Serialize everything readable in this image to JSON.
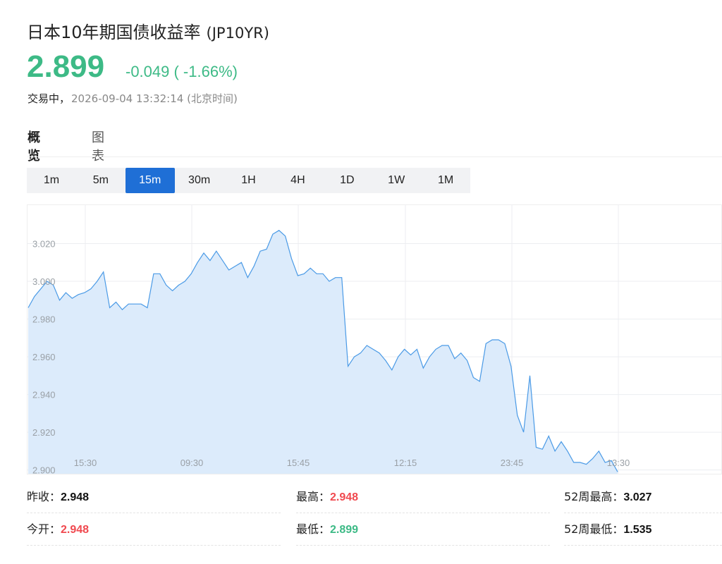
{
  "header": {
    "title": "日本10年期国债收益率",
    "code": "(JP10YR)",
    "price": "2.899",
    "change": "-0.049 ( -1.66%)",
    "status": "交易中，",
    "timestamp": "2026-09-04 13:32:14 (北京时间)"
  },
  "tabs": [
    {
      "label": "概览",
      "active": true
    },
    {
      "label": "图表",
      "active": false
    }
  ],
  "periods": [
    "1m",
    "5m",
    "15m",
    "30m",
    "1H",
    "4H",
    "1D",
    "1W",
    "1M"
  ],
  "selected_period": "15m",
  "colors": {
    "up": "#f0494f",
    "down": "#3dba86",
    "accent": "#1f6fd6",
    "line": "#4a9ae6",
    "fill": "#dcebfb"
  },
  "chart_data": {
    "type": "area",
    "y_ticks": [
      "3.020",
      "3.000",
      "2.980",
      "2.960",
      "2.940",
      "2.920",
      "2.900"
    ],
    "x_ticks": [
      "15:30",
      "09:30",
      "15:45",
      "12:15",
      "23:45",
      "13:30"
    ],
    "ylim": [
      2.9,
      3.03
    ],
    "grid": true,
    "values": [
      2.986,
      2.992,
      2.996,
      3.0,
      2.998,
      2.99,
      2.994,
      2.991,
      2.993,
      2.994,
      2.996,
      3.0,
      3.005,
      2.986,
      2.989,
      2.985,
      2.988,
      2.988,
      2.988,
      2.986,
      3.004,
      3.004,
      2.998,
      2.995,
      2.998,
      3.0,
      3.004,
      3.01,
      3.015,
      3.011,
      3.016,
      3.011,
      3.006,
      3.008,
      3.01,
      3.002,
      3.008,
      3.016,
      3.017,
      3.025,
      3.027,
      3.024,
      3.012,
      3.003,
      3.004,
      3.007,
      3.004,
      3.004,
      3.0,
      3.002,
      3.002,
      2.955,
      2.96,
      2.962,
      2.966,
      2.964,
      2.962,
      2.958,
      2.953,
      2.96,
      2.964,
      2.961,
      2.964,
      2.954,
      2.96,
      2.964,
      2.966,
      2.966,
      2.959,
      2.962,
      2.958,
      2.949,
      2.947,
      2.967,
      2.969,
      2.969,
      2.967,
      2.955,
      2.929,
      2.92,
      2.95,
      2.912,
      2.911,
      2.918,
      2.91,
      2.915,
      2.91,
      2.904,
      2.904,
      2.903,
      2.906,
      2.91,
      2.904,
      2.905,
      2.899
    ]
  },
  "stats": [
    [
      {
        "label": "昨收：",
        "value": "2.948",
        "color": "black"
      },
      {
        "label": "最高：",
        "value": "2.948",
        "color": "red"
      },
      {
        "label": "52周最高：",
        "value": "3.027",
        "color": "black"
      }
    ],
    [
      {
        "label": "今开：",
        "value": "2.948",
        "color": "red"
      },
      {
        "label": "最低：",
        "value": "2.899",
        "color": "green"
      },
      {
        "label": "52周最低：",
        "value": "1.535",
        "color": "black"
      }
    ]
  ]
}
